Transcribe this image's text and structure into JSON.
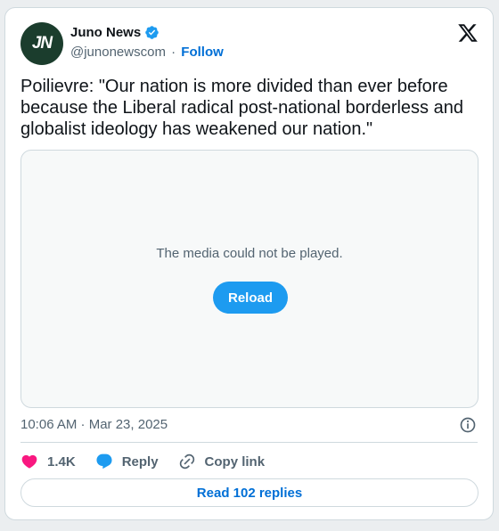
{
  "account": {
    "avatar_text": "JN",
    "name": "Juno News",
    "handle": "@junonewscom",
    "separator": "·",
    "follow_label": "Follow"
  },
  "tweet": {
    "text": "Poilievre: \"Our nation is more divided than ever before because the Liberal radical post-national borderless and globalist ideology has weakened our nation.\""
  },
  "media": {
    "message": "The media could not be played.",
    "reload_label": "Reload"
  },
  "meta": {
    "timestamp": "10:06 AM · Mar 23, 2025"
  },
  "actions": {
    "likes_count": "1.4K",
    "reply_label": "Reply",
    "copy_link_label": "Copy link"
  },
  "replies": {
    "read_label": "Read 102 replies"
  },
  "colors": {
    "accent": "#1d9bf0",
    "link": "#006fd6",
    "heart": "#f91880",
    "avatar_bg": "#1b3d2d"
  },
  "icons": [
    "verified-badge-icon",
    "x-logo-icon",
    "info-icon",
    "heart-icon",
    "reply-bubble-icon",
    "link-icon"
  ]
}
